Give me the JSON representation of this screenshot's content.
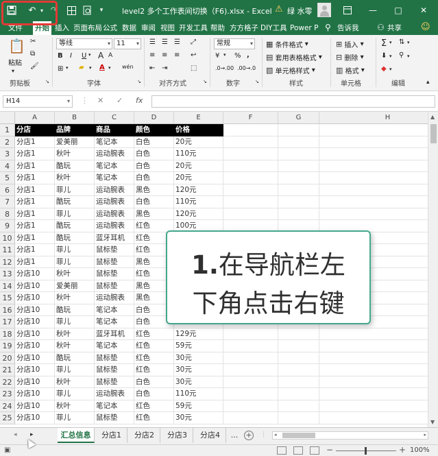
{
  "titlebar": {
    "filename": "level2 多个工作表间切换（F6).xlsx  -  Excel",
    "user": "绿 水零",
    "restore_icon": "restore-icon",
    "minimize": "—",
    "maximize": "□",
    "close": "✕"
  },
  "menu": {
    "tabs": [
      "文件",
      "开始",
      "插入",
      "页面布局",
      "公式",
      "数据",
      "审阅",
      "视图",
      "开发工具",
      "帮助",
      "方方格子",
      "DIY工具",
      "Power P",
      "告诉我",
      "共享"
    ],
    "active": "开始"
  },
  "ribbon": {
    "paste": "粘贴",
    "clipboard": "剪贴板",
    "font_name": "等线",
    "font_size": "11",
    "font_group": "字体",
    "bold": "B",
    "italic": "I",
    "underline": "U",
    "font_a_big": "A",
    "font_a_small": "A",
    "align_group": "对齐方式",
    "number_format": "常规",
    "number_group": "数字",
    "percent": "%",
    "comma": ",",
    "currency": "¥",
    "cond_format": "条件格式",
    "table_format": "套用表格格式",
    "cell_style": "单元格样式",
    "style_group": "样式",
    "insert": "插入",
    "delete": "删除",
    "format": "格式",
    "cells_group": "单元格",
    "edit_group": "编辑"
  },
  "formula": {
    "namebox": "H14",
    "fx": "fx",
    "cancel": "✕",
    "confirm": "✓",
    "content": ""
  },
  "columns": [
    "A",
    "B",
    "C",
    "D",
    "E",
    "F",
    "G",
    "H"
  ],
  "table": {
    "headers": [
      "分店",
      "品牌",
      "商品",
      "颜色",
      "价格"
    ],
    "rows": [
      [
        "分店1",
        "爱美丽",
        "笔记本",
        "白色",
        "20元"
      ],
      [
        "分店1",
        "秋叶",
        "运动腕表",
        "白色",
        "110元"
      ],
      [
        "分店1",
        "酷玩",
        "笔记本",
        "白色",
        "20元"
      ],
      [
        "分店1",
        "秋叶",
        "笔记本",
        "白色",
        "20元"
      ],
      [
        "分店1",
        "菲儿",
        "运动腕表",
        "黑色",
        "120元"
      ],
      [
        "分店1",
        "酷玩",
        "运动腕表",
        "白色",
        "110元"
      ],
      [
        "分店1",
        "菲儿",
        "运动腕表",
        "黑色",
        "120元"
      ],
      [
        "分店1",
        "酷玩",
        "运动腕表",
        "红色",
        "100元"
      ],
      [
        "分店1",
        "酷玩",
        "蓝牙耳机",
        "红色",
        ""
      ],
      [
        "分店1",
        "菲儿",
        "鼠标垫",
        "红色",
        ""
      ],
      [
        "分店1",
        "菲儿",
        "鼠标垫",
        "黑色",
        ""
      ],
      [
        "分店10",
        "秋叶",
        "鼠标垫",
        "红色",
        ""
      ],
      [
        "分店10",
        "爱美丽",
        "鼠标垫",
        "黑色",
        ""
      ],
      [
        "分店10",
        "秋叶",
        "运动腕表",
        "黑色",
        ""
      ],
      [
        "分店10",
        "酷玩",
        "笔记本",
        "白色",
        ""
      ],
      [
        "分店10",
        "菲儿",
        "笔记本",
        "白色",
        ""
      ],
      [
        "分店10",
        "秋叶",
        "蓝牙耳机",
        "红色",
        "129元"
      ],
      [
        "分店10",
        "秋叶",
        "笔记本",
        "红色",
        "59元"
      ],
      [
        "分店10",
        "酷玩",
        "鼠标垫",
        "红色",
        "30元"
      ],
      [
        "分店10",
        "菲儿",
        "鼠标垫",
        "红色",
        "30元"
      ],
      [
        "分店10",
        "秋叶",
        "鼠标垫",
        "白色",
        "30元"
      ],
      [
        "分店10",
        "菲儿",
        "运动腕表",
        "白色",
        "110元"
      ],
      [
        "分店10",
        "秋叶",
        "笔记本",
        "红色",
        "59元"
      ],
      [
        "分店10",
        "菲儿",
        "鼠标垫",
        "红色",
        "30元"
      ]
    ]
  },
  "callout": {
    "num": "1.",
    "line1": "在导航栏左",
    "line2": "下角点击右键"
  },
  "sheets": {
    "tabs": [
      "汇总信息",
      "分店1",
      "分店2",
      "分店3",
      "分店4",
      "..."
    ],
    "active": "汇总信息",
    "add": "+",
    "prev": "◂",
    "next": "▸"
  },
  "status": {
    "zoom": "100%",
    "zoom_minus": "−",
    "zoom_plus": "+"
  },
  "colors": {
    "excel_green": "#217346",
    "callout_border": "#44a88c",
    "highlight_red": "#e53935"
  }
}
